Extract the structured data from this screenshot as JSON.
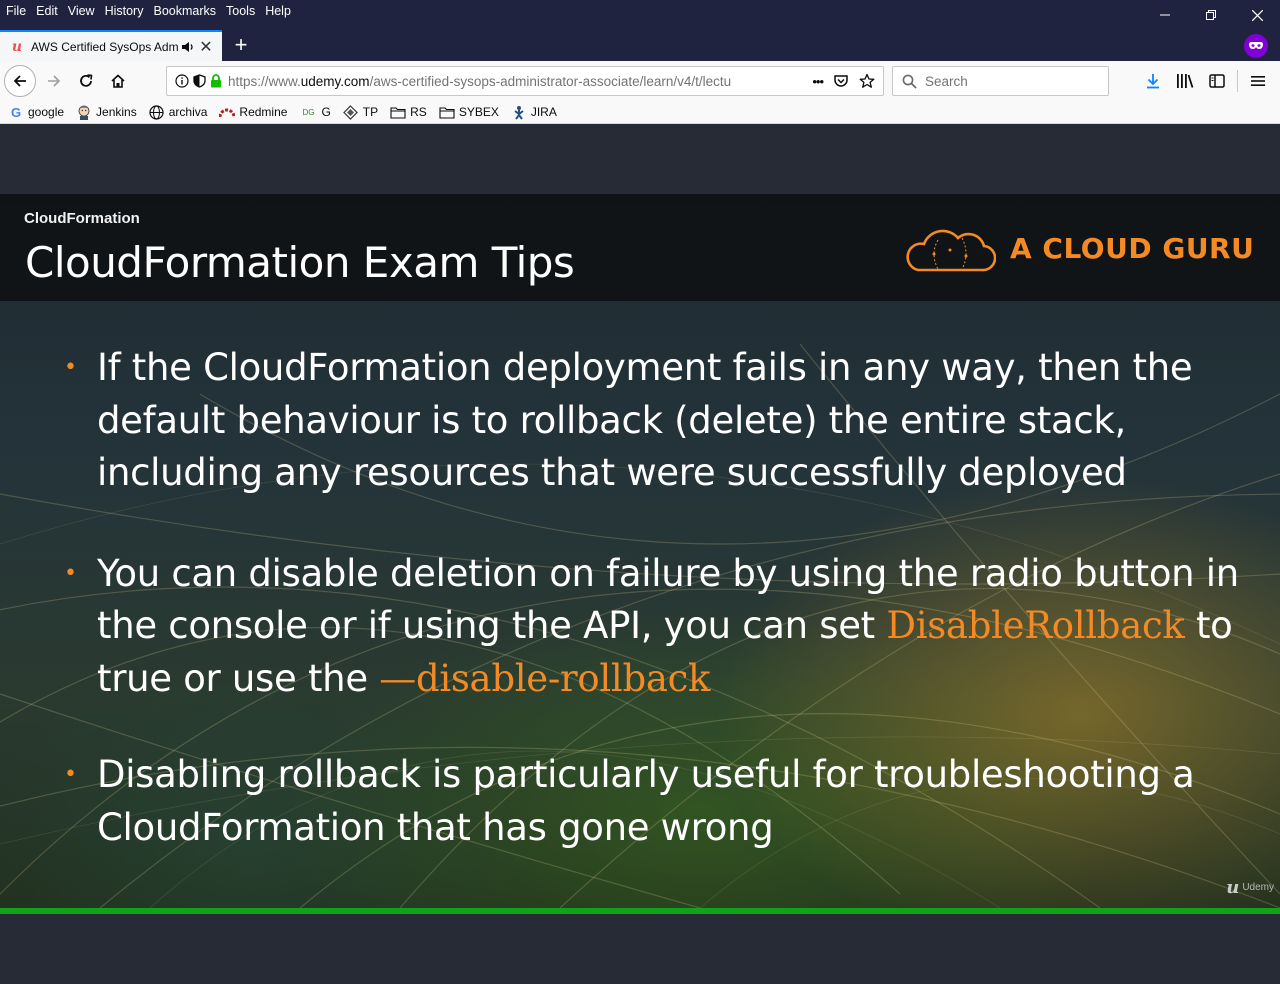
{
  "menubar": {
    "items": [
      "File",
      "Edit",
      "View",
      "History",
      "Bookmarks",
      "Tools",
      "Help"
    ]
  },
  "window_controls": {
    "minimize": "—",
    "restore": "❐",
    "close": "✕"
  },
  "tab": {
    "title": "AWS Certified SysOps Admi",
    "favicon": "udemy-icon",
    "close": "✕"
  },
  "new_tab": "+",
  "nav": {
    "url_prefix": "https://www.",
    "url_domain": "udemy.com",
    "url_path": "/aws-certified-sysops-administrator-associate/learn/v4/t/lectu",
    "url_more": "•••",
    "search_placeholder": "Search"
  },
  "bookmarks": [
    {
      "label": "google",
      "icon": "google-icon"
    },
    {
      "label": "Jenkins",
      "icon": "jenkins-icon"
    },
    {
      "label": "archiva",
      "icon": "globe-icon"
    },
    {
      "label": "Redmine",
      "icon": "redmine-icon"
    },
    {
      "label": "G",
      "icon": "dg-icon"
    },
    {
      "label": "TP",
      "icon": "tp-icon"
    },
    {
      "label": "RS",
      "icon": "folder-icon"
    },
    {
      "label": "SYBEX",
      "icon": "folder-icon"
    },
    {
      "label": "JIRA",
      "icon": "jira-icon"
    }
  ],
  "slide": {
    "section": "CloudFormation",
    "title": "CloudFormation Exam Tips",
    "brand": "A CLOUD GURU",
    "bullets": [
      {
        "text": "If the CloudFormation deployment fails in any way, then the default behaviour is to rollback (delete) the entire stack, including any resources that were successfully deployed"
      },
      {
        "pre": "You can disable deletion on failure by using the radio button in the console or if using the API, you can set ",
        "hl1": "DisableRollback",
        "mid": " to true or use the ",
        "hl2": "—disable-rollback"
      },
      {
        "text": "Disabling rollback is particularly useful for troubleshooting a CloudFormation that has gone wrong"
      }
    ],
    "watermark_u": "u",
    "watermark": "Udemy"
  },
  "progress": 1.0,
  "colors": {
    "accent": "#f48a26",
    "chrome_dark": "#202340",
    "progress": "#0b8a14",
    "private": "#8000d7"
  }
}
